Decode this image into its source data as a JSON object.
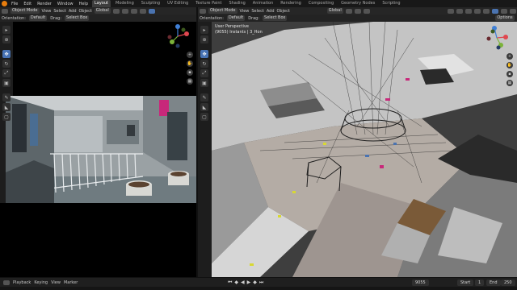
{
  "topbar": {
    "menu": [
      "File",
      "Edit",
      "Render",
      "Window",
      "Help"
    ],
    "workspaces": [
      "Layout",
      "Modeling",
      "Sculpting",
      "UV Editing",
      "Texture Paint",
      "Shading",
      "Animation",
      "Rendering",
      "Compositing",
      "Geometry Nodes",
      "Scripting"
    ],
    "active_workspace": "Layout"
  },
  "left_editor": {
    "header": {
      "mode": "Object Mode",
      "items": [
        "View",
        "Select",
        "Add",
        "Object"
      ],
      "orientation_label": "Global"
    },
    "subheader": {
      "orientation_label": "Orientation:",
      "orientation_value": "Default",
      "drag_label": "Drag:",
      "drag_value": "Select Box"
    }
  },
  "right_editor": {
    "header": {
      "mode": "Object Mode",
      "items": [
        "View",
        "Select",
        "Add",
        "Object"
      ],
      "orientation_label": "Global",
      "options_label": "Options"
    },
    "subheader": {
      "orientation_label": "Orientation:",
      "orientation_value": "Default",
      "drag_label": "Drag:",
      "drag_value": "Select Box"
    },
    "viewport_label": {
      "line1": "User Perspective",
      "line2": "(9055) Instants | 3_Hon"
    }
  },
  "timeline": {
    "playback_label": "Playback",
    "keying_label": "Keying",
    "view_label": "View",
    "marker_label": "Marker",
    "current_frame": "9055",
    "start_label": "Start",
    "start_value": "1",
    "end_label": "End",
    "end_value": "250"
  },
  "colors": {
    "accent": "#4772b3",
    "logo": "#e87d0d",
    "viewport_bg": "#474747",
    "selection_pink": "#c8287a",
    "highlight_yellow": "#d8d832"
  }
}
